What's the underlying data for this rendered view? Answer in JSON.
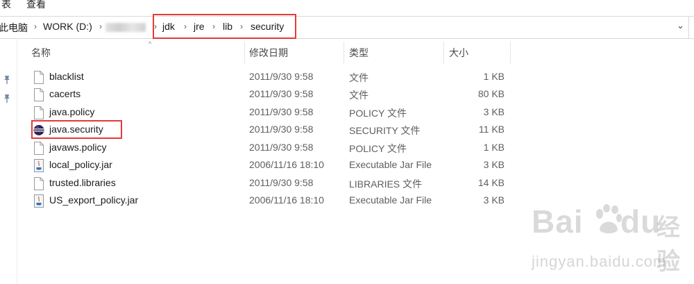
{
  "menu": {
    "partial_label": "查看",
    "left_partial": "表"
  },
  "address": {
    "crumbs": [
      "此电脑",
      "WORK (D:)",
      "jdk",
      "jre",
      "lib",
      "security"
    ],
    "separator": "›",
    "dropdown": "⌄"
  },
  "columns": {
    "name": "名称",
    "date": "修改日期",
    "type": "类型",
    "size": "大小"
  },
  "files": [
    {
      "name": "blacklist",
      "date": "2011/9/30 9:58",
      "type": "文件",
      "size": "1 KB",
      "icon": "file-icon"
    },
    {
      "name": "cacerts",
      "date": "2011/9/30 9:58",
      "type": "文件",
      "size": "80 KB",
      "icon": "file-icon"
    },
    {
      "name": "java.policy",
      "date": "2011/9/30 9:58",
      "type": "POLICY 文件",
      "size": "3 KB",
      "icon": "file-icon"
    },
    {
      "name": "java.security",
      "date": "2011/9/30 9:58",
      "type": "SECURITY 文件",
      "size": "11 KB",
      "icon": "eclipse-icon"
    },
    {
      "name": "javaws.policy",
      "date": "2011/9/30 9:58",
      "type": "POLICY 文件",
      "size": "1 KB",
      "icon": "file-icon"
    },
    {
      "name": "local_policy.jar",
      "date": "2006/11/16 18:10",
      "type": "Executable Jar File",
      "size": "3 KB",
      "icon": "jar-icon"
    },
    {
      "name": "trusted.libraries",
      "date": "2011/9/30 9:58",
      "type": "LIBRARIES 文件",
      "size": "14 KB",
      "icon": "file-icon"
    },
    {
      "name": "US_export_policy.jar",
      "date": "2006/11/16 18:10",
      "type": "Executable Jar File",
      "size": "3 KB",
      "icon": "jar-icon"
    }
  ],
  "watermark": {
    "brand_a": "Bai",
    "brand_b": "du",
    "brand_cn": "经验",
    "url": "jingyan.baidu.com"
  },
  "colors": {
    "highlight": "#e33a3a",
    "header_text": "#4a4a4a",
    "meta_text": "#5e5e5e"
  }
}
